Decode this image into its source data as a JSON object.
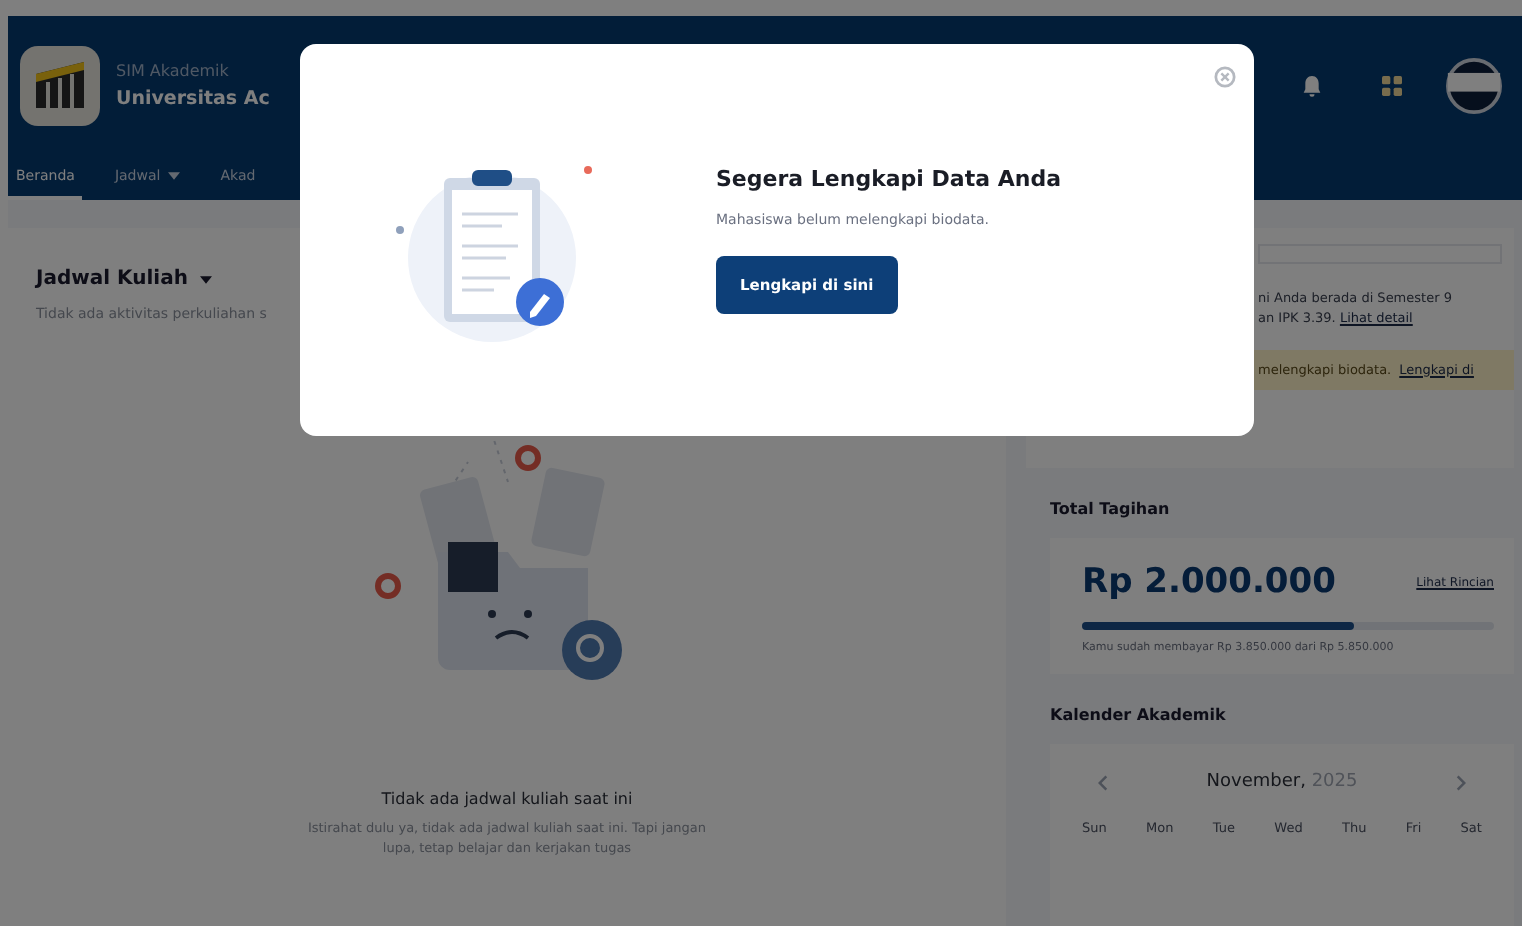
{
  "header": {
    "app_label": "SIM Akademik",
    "university": "Universitas Ac"
  },
  "nav": [
    {
      "label": "Beranda",
      "selected": true,
      "dropdown": false
    },
    {
      "label": "Jadwal",
      "selected": false,
      "dropdown": true
    },
    {
      "label": "Akad",
      "selected": false,
      "dropdown": false
    }
  ],
  "schedule": {
    "title": "Jadwal Kuliah",
    "note": "Tidak ada aktivitas perkuliahan s",
    "empty_title": "Tidak ada jadwal kuliah saat ini",
    "empty_text": "Istirahat dulu ya, tidak ada jadwal kuliah saat ini. Tapi jangan lupa, tetap belajar dan kerjakan tugas"
  },
  "profile": {
    "line_1": "ni Anda berada di Semester 9",
    "line_2": "an IPK 3.39.",
    "detail_link": "Lihat detail",
    "alert": "melengkapi biodata.",
    "alert_link": "Lengkapi di"
  },
  "billing": {
    "title": "Total Tagihan",
    "amount": "Rp 2.000.000",
    "link": "Lihat Rincian",
    "level": 0.66,
    "paid_text": "Kamu sudah membayar Rp 3.850.000 dari Rp 5.850.000"
  },
  "calendar": {
    "title": "Kalender Akademik",
    "month": "November,",
    "year": "2025",
    "weekdays": [
      "Sun",
      "Mon",
      "Tue",
      "Wed",
      "Thu",
      "Fri",
      "Sat"
    ]
  },
  "modal": {
    "title": "Segera Lengkapi Data Anda",
    "message": "Mahasiswa belum melengkapi biodata.",
    "button": "Lengkapi di sini"
  }
}
